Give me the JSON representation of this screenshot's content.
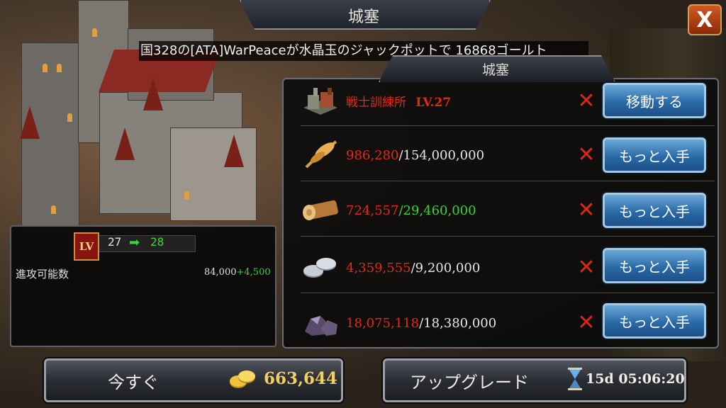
{
  "header": {
    "title": "城塞",
    "close_label": "X"
  },
  "ticker": {
    "text": "国328の[ATA]WarPeaceが水晶玉のジャックポットで 16868ゴールト"
  },
  "requirements_panel": {
    "title": "城塞",
    "rows": [
      {
        "icon": "barracks-icon",
        "name": "戦士訓練所",
        "level": "LV.27",
        "status_icon": "x-mark-icon",
        "button": "移動する"
      },
      {
        "icon": "food-wheat-icon",
        "have": "986,280",
        "need": "/154,000,000",
        "status_icon": "x-mark-icon",
        "button": "もっと入手"
      },
      {
        "icon": "wood-log-icon",
        "have": "724,557",
        "need": "/29,460,000",
        "status_icon": "x-mark-icon",
        "button": "もっと入手"
      },
      {
        "icon": "silver-coins-icon",
        "have": "4,359,555",
        "need": "/9,200,000",
        "status_icon": "x-mark-icon",
        "button": "もっと入手"
      },
      {
        "icon": "ore-stone-icon",
        "have": "18,075,118",
        "need": "/18,380,000",
        "status_icon": "x-mark-icon",
        "button": "もっと入手"
      }
    ]
  },
  "level_panel": {
    "badge": "LV",
    "from": "27",
    "to": "28",
    "stat_label": "進攻可能数",
    "stat_base": "84,000",
    "stat_bonus": "+4,500"
  },
  "actions": {
    "now_label": "今すぐ",
    "now_price": "663,644",
    "upgrade_label": "アップグレード",
    "upgrade_time": "15d 05:06:20"
  },
  "colors": {
    "insufficient": "#e02a1a",
    "sufficient": "#3cd23c",
    "gold": "#f2d060",
    "button_blue": "#2a6aa8"
  }
}
